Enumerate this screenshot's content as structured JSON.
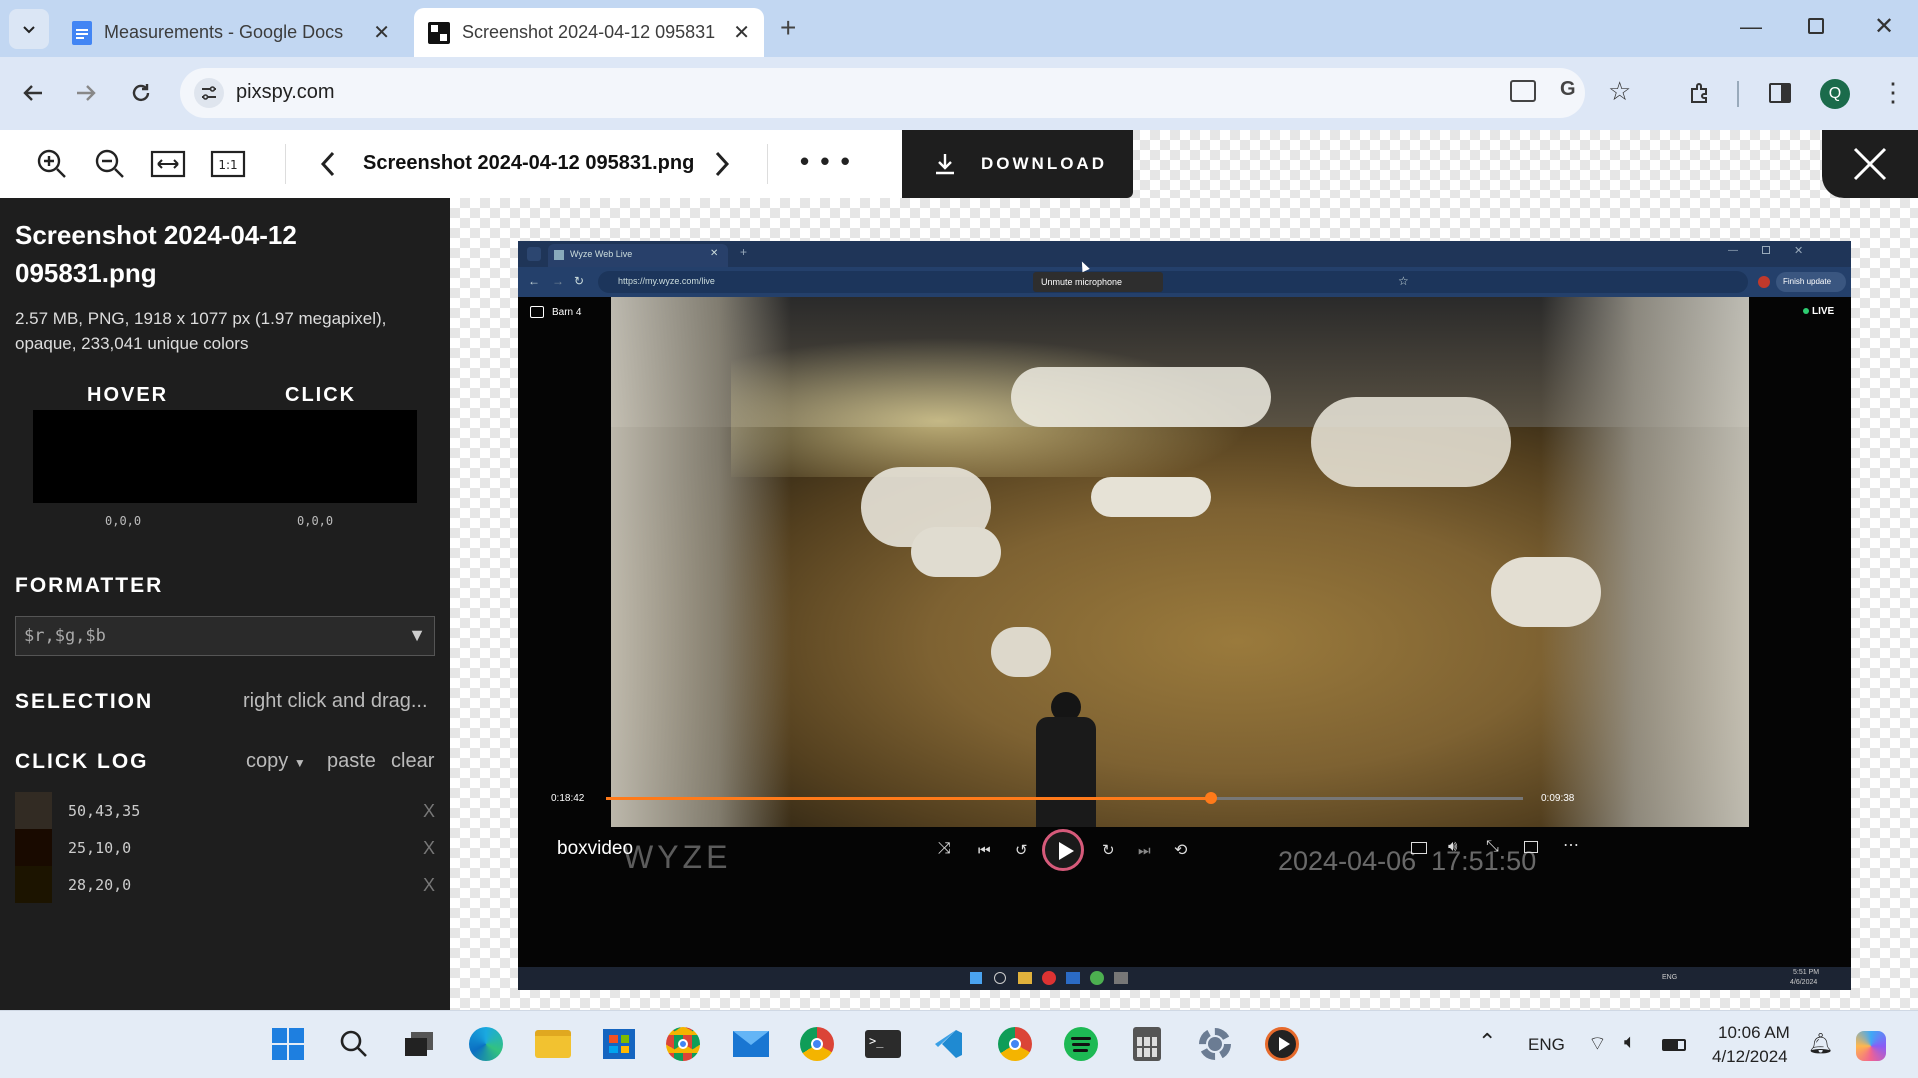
{
  "browser": {
    "tabs": [
      {
        "title": "Measurements - Google Docs",
        "icon": "google-docs-icon"
      },
      {
        "title": "Screenshot 2024-04-12 095831",
        "icon": "pixspy-icon",
        "active": true
      }
    ],
    "url": "pixspy.com",
    "profile_initial": "Q"
  },
  "pixspy": {
    "filename": "Screenshot 2024-04-12 095831.png",
    "download_label": "DOWNLOAD",
    "more_label": "• • •",
    "sidebar": {
      "title": "Screenshot 2024-04-12 095831.png",
      "info": "2.57 MB, PNG, 1918 x 1077 px (1.97 megapixel), opaque, 233,041 unique colors",
      "hover_label": "HOVER",
      "click_label": "CLICK",
      "hover_value": "0,0,0",
      "click_value": "0,0,0",
      "formatter_label": "FORMATTER",
      "formatter_value": "$r,$g,$b",
      "selection_label": "SELECTION",
      "selection_hint": "right click and drag...",
      "click_log_label": "CLICK LOG",
      "copy_label": "copy",
      "paste_label": "paste",
      "clear_label": "clear",
      "log": [
        {
          "value": "50,43,35",
          "color": "#322b23",
          "remove": "X"
        },
        {
          "value": "25,10,0",
          "color": "#190a00",
          "remove": "X"
        },
        {
          "value": "28,20,0",
          "color": "#1c1400",
          "remove": "X"
        }
      ]
    }
  },
  "inner": {
    "tab_title": "Wyze Web Live",
    "url": "https://my.wyze.com/live",
    "tooltip": "Unmute microphone",
    "finish_update": "Finish update",
    "camera_name": "Barn 4",
    "live_label": "LIVE",
    "time_elapsed": "0:18:42",
    "time_remaining": "0:09:38",
    "progress": 0.66,
    "player_brand": "boxvideo",
    "watermark": "WYZE",
    "timestamp": "2024-04-06  17:51:50",
    "mini_clock_time": "5:51 PM",
    "mini_clock_date": "4/6/2024",
    "mini_lang": "ENG"
  },
  "taskbar": {
    "lang": "ENG",
    "time": "10:06 AM",
    "date": "4/12/2024"
  }
}
